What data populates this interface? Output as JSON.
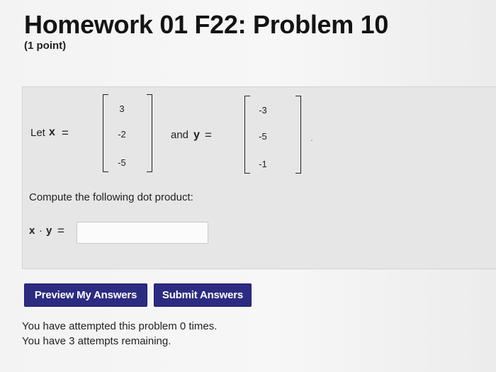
{
  "header": {
    "title": "Homework 01 F22: Problem 10",
    "points": "(1 point)"
  },
  "problem": {
    "let_text": "Let",
    "x_var": "x",
    "eq_sign": "=",
    "and_text": "and",
    "y_var": "y",
    "period": ".",
    "vector_x": [
      "3",
      "-2",
      "-5"
    ],
    "vector_y": [
      "-3",
      "-5",
      "-1"
    ],
    "instruction": "Compute the following dot product:",
    "dot_label_x": "x",
    "dot_operator": "·",
    "dot_label_y": "y",
    "answer_value": "",
    "answer_placeholder": ""
  },
  "buttons": {
    "preview_label": "Preview My Answers",
    "submit_label": "Submit Answers"
  },
  "status": {
    "attempted": "You have attempted this problem 0 times.",
    "remaining": "You have 3 attempts remaining."
  },
  "colors": {
    "button_background": "#2b2b82",
    "button_text": "#ffffff",
    "problem_background": "#e6e6e6"
  }
}
